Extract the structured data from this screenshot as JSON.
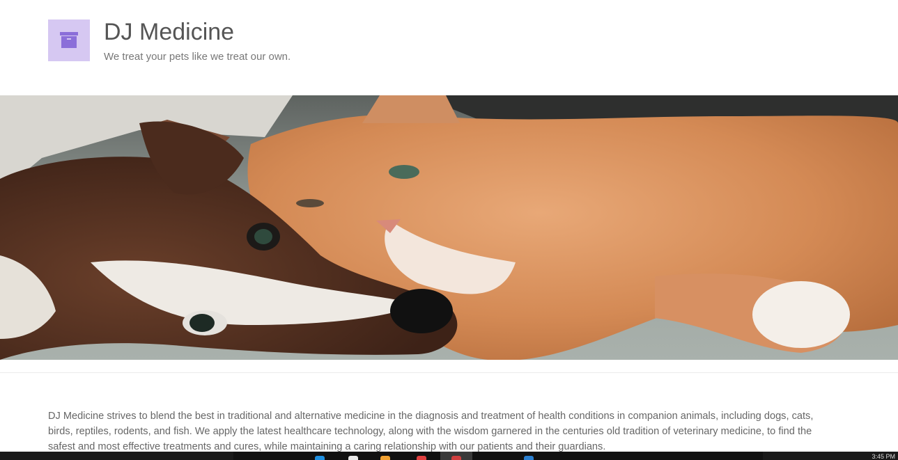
{
  "site": {
    "title": "DJ Medicine",
    "tagline": "We treat your pets like we treat our own.",
    "logo_icon": "archive-box-icon",
    "logo_bg": "#d6c8f2",
    "logo_fg": "#8b6fd9"
  },
  "hero": {
    "image_name": "dog-and-cat-photo"
  },
  "intro": {
    "text": "DJ Medicine strives to blend the best in traditional and alternative medicine in the diagnosis and treatment of health conditions in companion animals, including dogs, cats, birds, reptiles, rodents, and fish. We apply the latest healthcare technology, along with the wisdom garnered in the centuries old tradition of veterinary medicine, to find the safest and most effective treatments and cures, while maintaining a caring relationship with our patients and their guardians."
  },
  "taskbar": {
    "clock": "3:45 PM",
    "icons": [
      "edge-icon",
      "chrome-icon",
      "file-explorer-icon",
      "app-icon",
      "app-icon",
      "store-icon"
    ]
  }
}
